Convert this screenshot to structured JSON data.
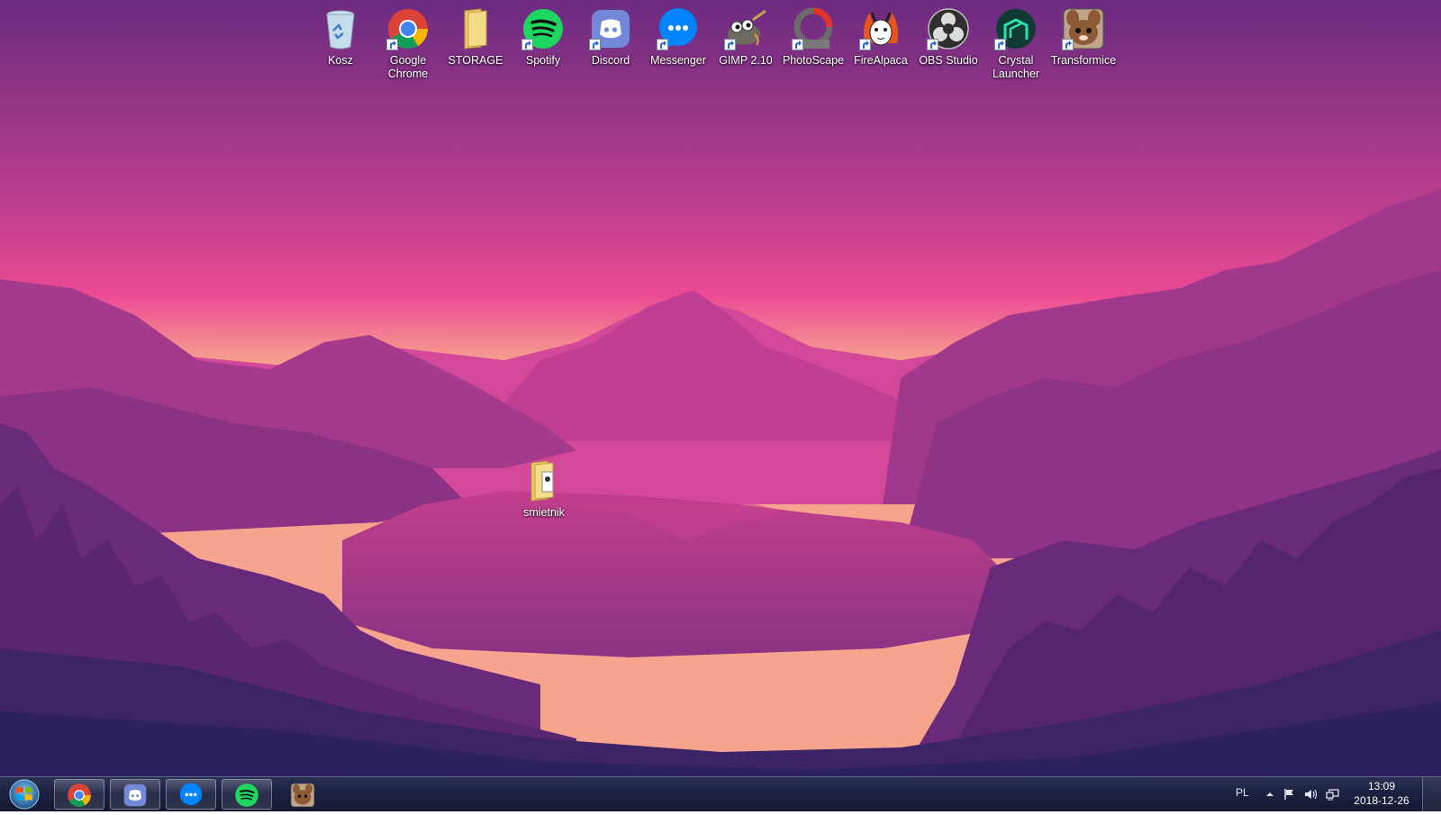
{
  "desktop": {
    "icons": [
      {
        "name": "Kosz",
        "icon": "recycle-bin-icon",
        "shortcut": false
      },
      {
        "name": "Google\nChrome",
        "icon": "chrome-icon",
        "shortcut": true
      },
      {
        "name": "STORAGE",
        "icon": "folder-icon",
        "shortcut": false
      },
      {
        "name": "Spotify",
        "icon": "spotify-icon",
        "shortcut": true
      },
      {
        "name": "Discord",
        "icon": "discord-icon",
        "shortcut": true
      },
      {
        "name": "Messenger",
        "icon": "messenger-icon",
        "shortcut": true
      },
      {
        "name": "GIMP 2.10",
        "icon": "gimp-icon",
        "shortcut": true
      },
      {
        "name": "PhotoScape",
        "icon": "photoscape-icon",
        "shortcut": true
      },
      {
        "name": "FireAlpaca",
        "icon": "firealpaca-icon",
        "shortcut": true
      },
      {
        "name": "OBS Studio",
        "icon": "obs-icon",
        "shortcut": true
      },
      {
        "name": "Crystal\nLauncher",
        "icon": "crystal-launcher-icon",
        "shortcut": true
      },
      {
        "name": "Transformice",
        "icon": "transformice-icon",
        "shortcut": true
      }
    ],
    "folder_icon": {
      "name": "smietnik",
      "icon": "folder-icon"
    }
  },
  "taskbar": {
    "pinned": [
      {
        "app": "Google Chrome",
        "icon": "chrome-icon"
      },
      {
        "app": "Discord",
        "icon": "discord-icon"
      },
      {
        "app": "Messenger",
        "icon": "messenger-icon"
      },
      {
        "app": "Spotify",
        "icon": "spotify-icon"
      },
      {
        "app": "Transformice",
        "icon": "transformice-icon"
      }
    ],
    "tray": {
      "language": "PL",
      "time": "13:09",
      "date": "2018-12-26"
    }
  },
  "colors": {
    "sky_top": "#6a2a7e",
    "sky_horizon": "#f6a08e",
    "pink": "#e8489a",
    "spotify": "#1ed760",
    "discord": "#7289da",
    "messenger": "#0084ff",
    "taskbar": "#1b2140"
  }
}
